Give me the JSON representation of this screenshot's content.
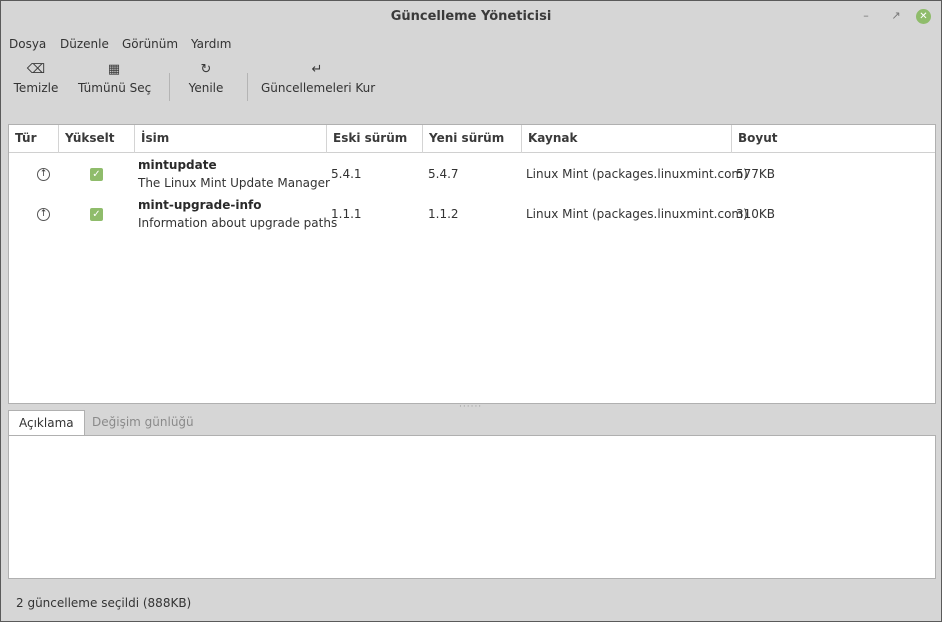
{
  "window": {
    "title": "Güncelleme Yöneticisi"
  },
  "menu": [
    "Dosya",
    "Düzenle",
    "Görünüm",
    "Yardım"
  ],
  "toolbar": {
    "clear": {
      "label": "Temizle",
      "icon": "backspace-icon"
    },
    "select_all": {
      "label": "Tümünü Seç",
      "icon": "select-all-icon"
    },
    "refresh": {
      "label": "Yenile",
      "icon": "refresh-icon"
    },
    "install": {
      "label": "Güncellemeleri Kur",
      "icon": "enter-icon"
    }
  },
  "columns": [
    "Tür",
    "Yükselt",
    "İsim",
    "Eski sürüm",
    "Yeni sürüm",
    "Kaynak",
    "Boyut"
  ],
  "updates": [
    {
      "type_icon": "upgrade-arrow-icon",
      "checked": true,
      "name": "mintupdate",
      "description": "The Linux Mint Update Manager",
      "old_version": "5.4.1",
      "new_version": "5.4.7",
      "source": "Linux Mint (packages.linuxmint.com)",
      "size": "577KB"
    },
    {
      "type_icon": "upgrade-arrow-icon",
      "checked": true,
      "name": "mint-upgrade-info",
      "description": "Information about upgrade paths",
      "old_version": "1.1.1",
      "new_version": "1.1.2",
      "source": "Linux Mint (packages.linuxmint.com)",
      "size": "310KB"
    }
  ],
  "tabs": [
    "Açıklama",
    "Değişim günlüğü"
  ],
  "status": "2 güncelleme seçildi (888KB)",
  "colors": {
    "accent": "#8fbc6b",
    "window_bg": "#d6d6d6"
  }
}
